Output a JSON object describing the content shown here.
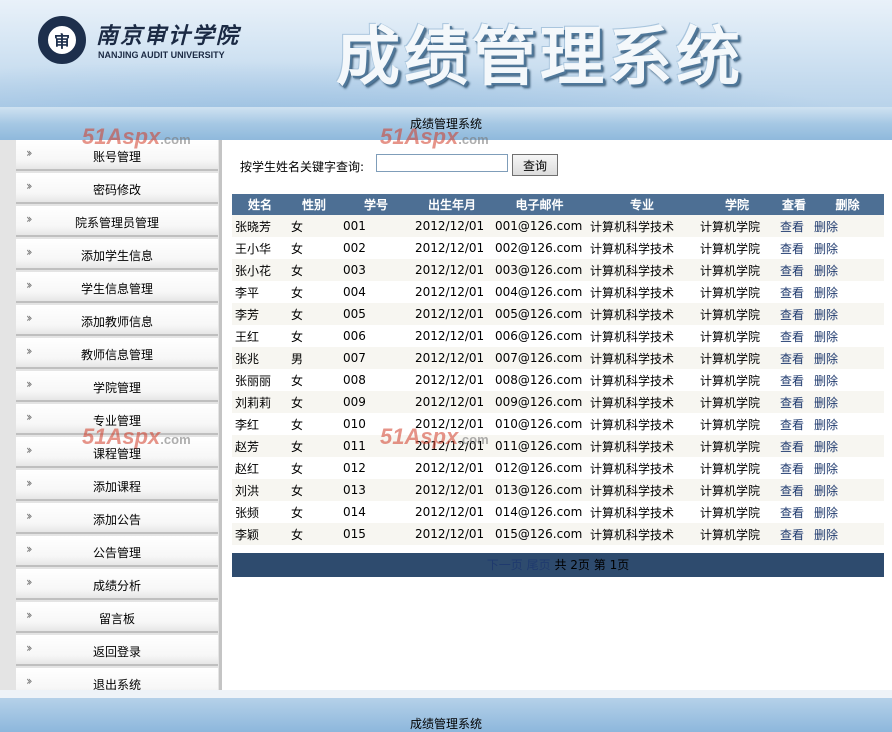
{
  "header": {
    "university_cn": "南京审计学院",
    "university_en": "NANJING AUDIT UNIVERSITY",
    "system_title": "成绩管理系统",
    "logo_text": "审"
  },
  "topbar": {
    "title": "成绩管理系统"
  },
  "sidebar": {
    "items": [
      {
        "label": "账号管理"
      },
      {
        "label": "密码修改"
      },
      {
        "label": "院系管理员管理"
      },
      {
        "label": "添加学生信息"
      },
      {
        "label": "学生信息管理"
      },
      {
        "label": "添加教师信息"
      },
      {
        "label": "教师信息管理"
      },
      {
        "label": "学院管理"
      },
      {
        "label": "专业管理"
      },
      {
        "label": "课程管理"
      },
      {
        "label": "添加课程"
      },
      {
        "label": "添加公告"
      },
      {
        "label": "公告管理"
      },
      {
        "label": "成绩分析"
      },
      {
        "label": "留言板"
      },
      {
        "label": "返回登录"
      },
      {
        "label": "退出系统"
      }
    ]
  },
  "search": {
    "label": "按学生姓名关键字查询:",
    "value": "",
    "button": "查询"
  },
  "table": {
    "headers": [
      "姓名",
      "性别",
      "学号",
      "出生年月",
      "电子邮件",
      "专业",
      "学院",
      "查看",
      "删除"
    ],
    "view_label": "查看",
    "delete_label": "删除",
    "rows": [
      {
        "name": "张晓芳",
        "gender": "女",
        "id": "001",
        "birth": "2012/12/01",
        "email": "001@126.com",
        "major": "计算机科学技术",
        "college": "计算机学院"
      },
      {
        "name": "王小华",
        "gender": "女",
        "id": "002",
        "birth": "2012/12/01",
        "email": "002@126.com",
        "major": "计算机科学技术",
        "college": "计算机学院"
      },
      {
        "name": "张小花",
        "gender": "女",
        "id": "003",
        "birth": "2012/12/01",
        "email": "003@126.com",
        "major": "计算机科学技术",
        "college": "计算机学院"
      },
      {
        "name": "李平",
        "gender": "女",
        "id": "004",
        "birth": "2012/12/01",
        "email": "004@126.com",
        "major": "计算机科学技术",
        "college": "计算机学院"
      },
      {
        "name": "李芳",
        "gender": "女",
        "id": "005",
        "birth": "2012/12/01",
        "email": "005@126.com",
        "major": "计算机科学技术",
        "college": "计算机学院"
      },
      {
        "name": "王红",
        "gender": "女",
        "id": "006",
        "birth": "2012/12/01",
        "email": "006@126.com",
        "major": "计算机科学技术",
        "college": "计算机学院"
      },
      {
        "name": "张兆",
        "gender": "男",
        "id": "007",
        "birth": "2012/12/01",
        "email": "007@126.com",
        "major": "计算机科学技术",
        "college": "计算机学院"
      },
      {
        "name": "张丽丽",
        "gender": "女",
        "id": "008",
        "birth": "2012/12/01",
        "email": "008@126.com",
        "major": "计算机科学技术",
        "college": "计算机学院"
      },
      {
        "name": "刘莉莉",
        "gender": "女",
        "id": "009",
        "birth": "2012/12/01",
        "email": "009@126.com",
        "major": "计算机科学技术",
        "college": "计算机学院"
      },
      {
        "name": "李红",
        "gender": "女",
        "id": "010",
        "birth": "2012/12/01",
        "email": "010@126.com",
        "major": "计算机科学技术",
        "college": "计算机学院"
      },
      {
        "name": "赵芳",
        "gender": "女",
        "id": "011",
        "birth": "2012/12/01",
        "email": "011@126.com",
        "major": "计算机科学技术",
        "college": "计算机学院"
      },
      {
        "name": "赵红",
        "gender": "女",
        "id": "012",
        "birth": "2012/12/01",
        "email": "012@126.com",
        "major": "计算机科学技术",
        "college": "计算机学院"
      },
      {
        "name": "刘洪",
        "gender": "女",
        "id": "013",
        "birth": "2012/12/01",
        "email": "013@126.com",
        "major": "计算机科学技术",
        "college": "计算机学院"
      },
      {
        "name": "张频",
        "gender": "女",
        "id": "014",
        "birth": "2012/12/01",
        "email": "014@126.com",
        "major": "计算机科学技术",
        "college": "计算机学院"
      },
      {
        "name": "李颖",
        "gender": "女",
        "id": "015",
        "birth": "2012/12/01",
        "email": "015@126.com",
        "major": "计算机科学技术",
        "college": "计算机学院"
      }
    ]
  },
  "pager": {
    "next": "下一页",
    "last": "尾页",
    "total": "共 2页",
    "current": "第 1页"
  },
  "watermark": {
    "text": "51Aspx",
    "suffix": ".com"
  },
  "footer": {
    "title": "成绩管理系统"
  },
  "colors": {
    "table_header": "#4d6f94",
    "pager_bg": "#2e4b6e",
    "link": "#1f3a6e",
    "banner_bg": "#b9d3ea"
  },
  "icons": {
    "sidebar_item": "double-chevron-right-icon",
    "logo": "university-seal-icon"
  }
}
